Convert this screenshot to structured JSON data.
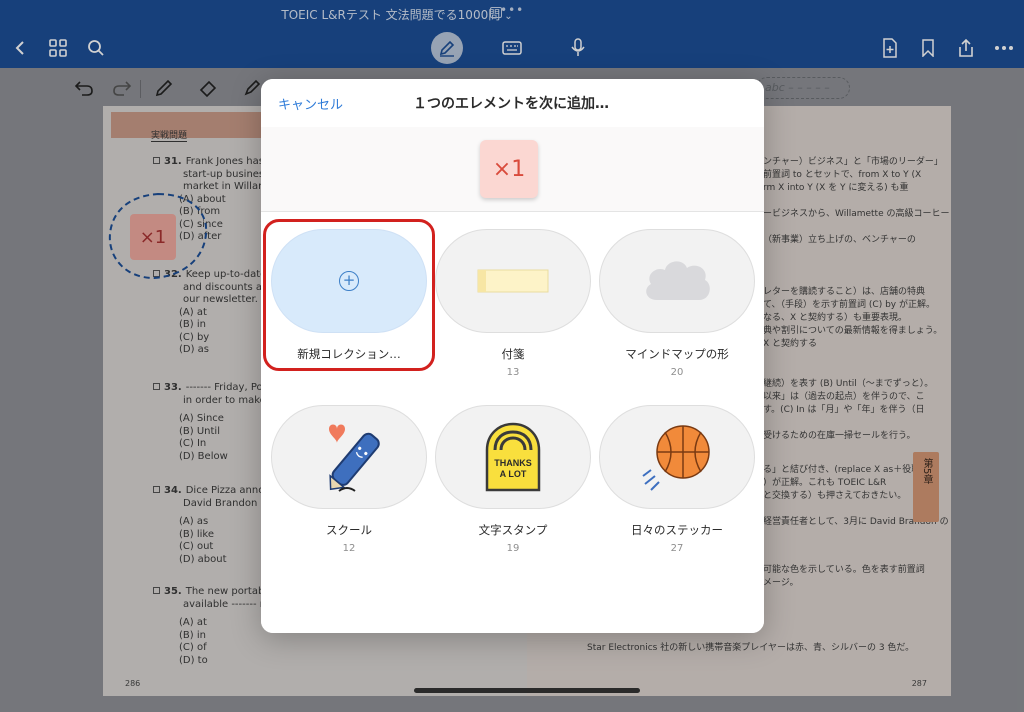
{
  "topbar": {
    "doc_title": "TOEIC L&Rテスト 文法問題でる1000問",
    "title_chevron": "⌄",
    "multitask_dots": "•••"
  },
  "toolbar": {
    "text_tool_placeholder": "abc – – – – –"
  },
  "page_left": {
    "band_label": "実戦問題",
    "page_number": "286",
    "questions": [
      {
        "num": "31.",
        "lines": [
          "Frank Jones has t",
          "start-up business",
          "market in Willame"
        ],
        "choices": [
          "(A) about",
          "(B) from",
          "(C) since",
          "(D) after"
        ]
      },
      {
        "num": "32.",
        "lines": [
          "Keep up-to-date",
          "and discounts at",
          "our newsletter."
        ],
        "choices": [
          "(A) at",
          "(B) in",
          "(C) by",
          "(D) as"
        ]
      },
      {
        "num": "33.",
        "lines": [
          "------- Friday, Por",
          "in order to make r"
        ],
        "choices": [
          "(A) Since",
          "(B) Until",
          "(C) In",
          "(D) Below"
        ]
      },
      {
        "num": "34.",
        "lines": [
          "Dice Pizza annou",
          "David Brandon --"
        ],
        "choices": [
          "(A) as",
          "(B) like",
          "(C) out",
          "(D) about"
        ]
      },
      {
        "num": "35.",
        "lines": [
          "The new portable",
          "available ------- re"
        ],
        "choices": [
          "(A) at",
          "(B) in",
          "(C) of",
          "(D) to"
        ]
      }
    ]
  },
  "page_right": {
    "page_number": "287",
    "text_lines": [
      "ンチャー）ビジネス」と「市場のリーダー」",
      "前置詞 to とセットで、from X to Y (X",
      "rm X into Y (X を Y に変える) も重",
      "ービジネスから、Willamette の高級コーヒー",
      "（新事業）立ち上げの、ベンチャーの",
      "レターを購読すること）は、店舗の特典",
      "て、（手段）を示す前置詞 (C) by が正解。",
      "なる、X と契約する）も重要表現。",
      "典や割引についての最新情報を得ましょう。",
      "X と契約する",
      "継続）を表す (B) Until（～までずっと）。",
      "以来」は（過去の起点）を伴うので、こ",
      "す。(C) In は「月」や「年」を伴う（日",
      "受けるための在庫一掃セールを行う。",
      "る」と結び付き、(replace X as＋役職)",
      "）が正解。これも TOEIC L&R",
      "と交換する）も押さえておきたい。",
      "経営責任者として、3月に David Brandon の",
      "可能な色を示している。色を表す前置詞",
      "メージ。",
      "Star Electronics 社の新しい携帯音楽プレイヤーは赤、青、シルバーの 3 色だ。"
    ],
    "chapter_tab_num": "第5章"
  },
  "canvas_element": {
    "label": "×1"
  },
  "modal": {
    "cancel_label": "キャンセル",
    "title": "１つのエレメントを次に追加…",
    "preview_label": "×1",
    "items": [
      {
        "label": "新規コレクション…",
        "count": "",
        "icon": "plus-circle-icon"
      },
      {
        "label": "付箋",
        "count": "13",
        "icon": "sticky-note-icon"
      },
      {
        "label": "マインドマップの形",
        "count": "20",
        "icon": "cloud-shape-icon"
      },
      {
        "label": "スクール",
        "count": "12",
        "icon": "pen-heart-sticker-icon"
      },
      {
        "label": "文字スタンプ",
        "count": "19",
        "icon": "thanks-a-lot-stamp-icon"
      },
      {
        "label": "日々のステッカー",
        "count": "27",
        "icon": "basketball-sticker-icon"
      }
    ],
    "stamp_text_line1": "THANKS",
    "stamp_text_line2": "A LOT",
    "accent_color": "#2e7bd8",
    "selection_color": "#d2211e"
  }
}
